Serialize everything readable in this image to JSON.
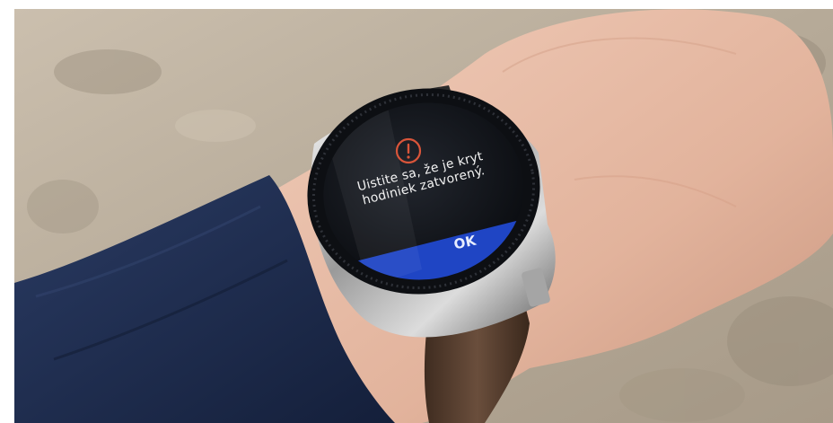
{
  "watch": {
    "dialog": {
      "icon": "alert-icon",
      "message_line1": "Uistite sa, že je kryt",
      "message_line2": "hodiniek zatvorený.",
      "ok_label": "OK"
    }
  },
  "colors": {
    "alert_icon": "#d9553a",
    "ok_button": "#1f45c4",
    "sleeve": "#1d2c4f",
    "strap": "#5a4232",
    "skin": "#e4b9a3"
  }
}
